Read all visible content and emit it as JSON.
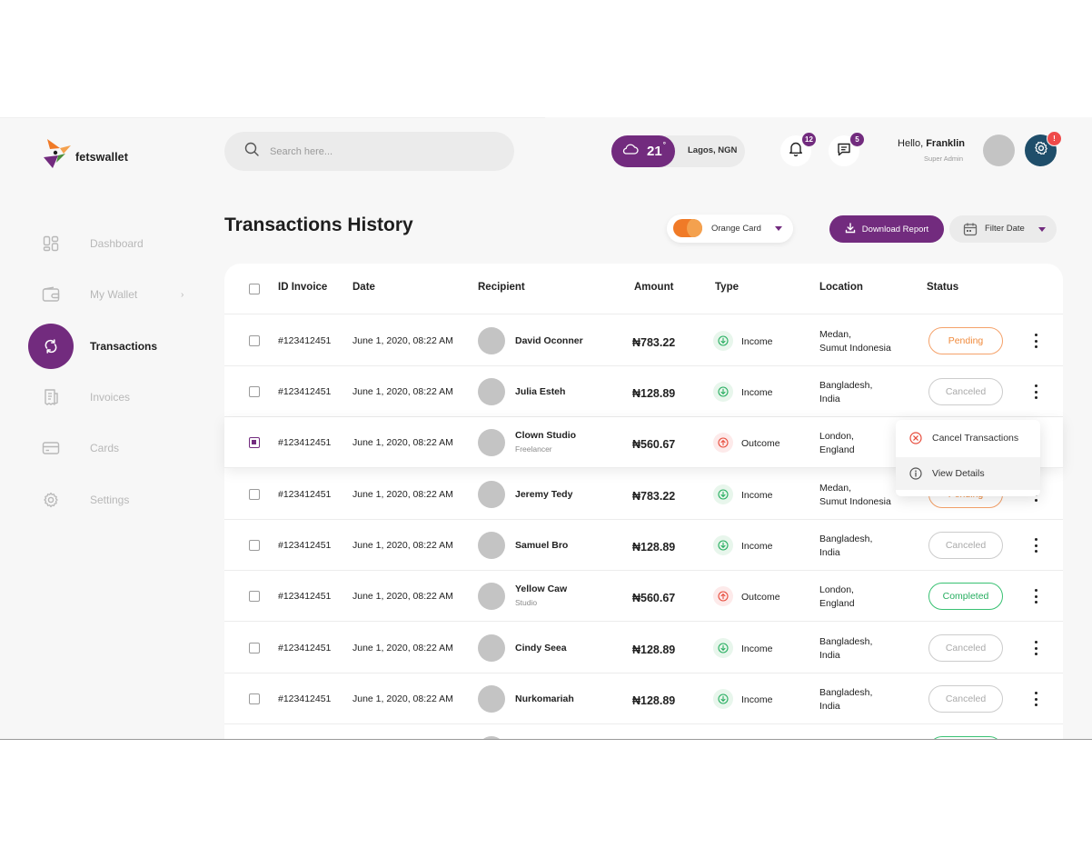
{
  "brand": {
    "name": "fetswallet"
  },
  "search": {
    "placeholder": "Search here..."
  },
  "weather": {
    "temperature": "21",
    "degree": "°",
    "location": "Lagos, NGN"
  },
  "notifications": {
    "bell_count": "12",
    "message_count": "5",
    "settings_alert": "!"
  },
  "user": {
    "greeting": "Hello,",
    "name": "Franklin",
    "role": "Super Admin"
  },
  "sidebar": {
    "items": [
      {
        "label": "Dashboard",
        "icon": "dashboard-icon"
      },
      {
        "label": "My Wallet",
        "icon": "wallet-icon"
      },
      {
        "label": "Transactions",
        "icon": "transactions-icon",
        "active": true
      },
      {
        "label": "Invoices",
        "icon": "invoice-icon"
      },
      {
        "label": "Cards",
        "icon": "card-icon"
      },
      {
        "label": "Settings",
        "icon": "settings-icon"
      }
    ]
  },
  "page": {
    "title": "Transactions History",
    "card_select": "Orange Card",
    "download_label": "Download Report",
    "filter_label": "Filter Date"
  },
  "table": {
    "headers": [
      "ID Invoice",
      "Date",
      "Recipient",
      "Amount",
      "Type",
      "Location",
      "Status"
    ],
    "rows": [
      {
        "id": "#123412451",
        "date": "June 1, 2020, 08:22 AM",
        "name": "David Oconner",
        "sub": "",
        "amount": "₦783.22",
        "type": "Income",
        "loc1": "Medan,",
        "loc2": "Sumut Indonesia",
        "status": "Pending"
      },
      {
        "id": "#123412451",
        "date": "June 1, 2020, 08:22 AM",
        "name": "Julia Esteh",
        "sub": "",
        "amount": "₦128.89",
        "type": "Income",
        "loc1": "Bangladesh,",
        "loc2": "India",
        "status": "Canceled"
      },
      {
        "id": "#123412451",
        "date": "June 1, 2020, 08:22 AM",
        "name": "Clown Studio",
        "sub": "Freelancer",
        "amount": "₦560.67",
        "type": "Outcome",
        "loc1": "London,",
        "loc2": "England",
        "status": ""
      },
      {
        "id": "#123412451",
        "date": "June 1, 2020, 08:22 AM",
        "name": "Jeremy Tedy",
        "sub": "",
        "amount": "₦783.22",
        "type": "Income",
        "loc1": "Medan,",
        "loc2": "Sumut Indonesia",
        "status": "Pending"
      },
      {
        "id": "#123412451",
        "date": "June 1, 2020, 08:22 AM",
        "name": "Samuel Bro",
        "sub": "",
        "amount": "₦128.89",
        "type": "Income",
        "loc1": "Bangladesh,",
        "loc2": "India",
        "status": "Canceled"
      },
      {
        "id": "#123412451",
        "date": "June 1, 2020, 08:22 AM",
        "name": "Yellow Caw",
        "sub": "Studio",
        "amount": "₦560.67",
        "type": "Outcome",
        "loc1": "London,",
        "loc2": "England",
        "status": "Completed"
      },
      {
        "id": "#123412451",
        "date": "June 1, 2020, 08:22 AM",
        "name": "Cindy Seea",
        "sub": "",
        "amount": "₦128.89",
        "type": "Income",
        "loc1": "Bangladesh,",
        "loc2": "India",
        "status": "Canceled"
      },
      {
        "id": "#123412451",
        "date": "June 1, 2020, 08:22 AM",
        "name": "Nurkomariah",
        "sub": "",
        "amount": "₦128.89",
        "type": "Income",
        "loc1": "Bangladesh,",
        "loc2": "India",
        "status": "Canceled"
      }
    ]
  },
  "context_menu": {
    "cancel_label": "Cancel Transactions",
    "details_label": "View Details"
  },
  "colors": {
    "primary": "#722b7e",
    "dark_teal": "#1f4e6a",
    "income": "#27ae60",
    "outcome": "#e74c3c",
    "pending": "#f08a3c"
  }
}
